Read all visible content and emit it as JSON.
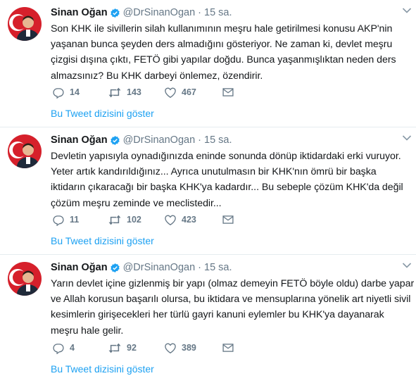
{
  "colors": {
    "link": "#1da1f2",
    "muted": "#657786",
    "text": "#14171a",
    "verified": "#1da1f2",
    "avatar_red": "#d6202b"
  },
  "icons": {
    "verified": "verified-badge-icon",
    "caret": "chevron-down-icon",
    "reply": "reply-icon",
    "retweet": "retweet-icon",
    "like": "heart-icon",
    "dm": "envelope-icon"
  },
  "tweets": [
    {
      "author": {
        "name": "Sinan Oğan",
        "handle": "@DrSinanOgan"
      },
      "separator": "·",
      "time": "15 sa.",
      "text_lines": [
        "Son KHK ile sivillerin silah kullanımının meşru hale getirilmesi konusu AKP'nin",
        "yaşanan bunca şeyden ders almadığını gösteriyor. Ne zaman ki, devlet meşru",
        "çizgisi dışına çıktı, FETÖ gibi yapılar doğdu. Bunca yaşanmışlıktan neden ders",
        "almazsınız? Bu KHK darbeyi önlemez, özendirir."
      ],
      "replies": "14",
      "retweets": "143",
      "likes": "467",
      "show_thread": "Bu Tweet dizisini göster"
    },
    {
      "author": {
        "name": "Sinan Oğan",
        "handle": "@DrSinanOgan"
      },
      "separator": "·",
      "time": "15 sa.",
      "text_lines": [
        "Devletin yapısıyla oynadığınızda eninde sonunda dönüp iktidardaki erki vuruyor.",
        "Yeter artık kandırıldığınız... Ayrıca unutulmasın bir KHK'nın ömrü bir başka",
        "iktidarın çıkaracağı bir başka KHK'ya kadardır... Bu sebeple çözüm KHK'da değil",
        "çözüm meşru zeminde ve meclistedir..."
      ],
      "replies": "11",
      "retweets": "102",
      "likes": "423",
      "show_thread": "Bu Tweet dizisini göster"
    },
    {
      "author": {
        "name": "Sinan Oğan",
        "handle": "@DrSinanOgan"
      },
      "separator": "·",
      "time": "15 sa.",
      "text_lines": [
        "Yarın devlet içine gizlenmiş bir yapı (olmaz demeyin FETÖ böyle oldu) darbe yapar",
        "ve Allah korusun başarılı olursa, bu iktidara ve mensuplarına yönelik art niyetli sivil",
        "kesimlerin girişecekleri her türlü gayri kanuni eylemler bu KHK'ya dayanarak",
        "meşru hale gelir."
      ],
      "replies": "4",
      "retweets": "92",
      "likes": "389",
      "show_thread": "Bu Tweet dizisini göster"
    }
  ]
}
